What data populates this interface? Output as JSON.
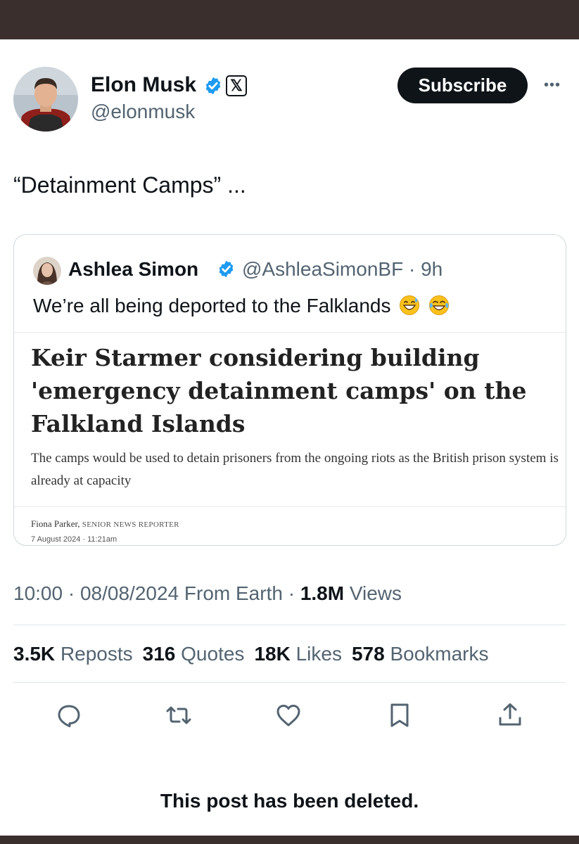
{
  "post": {
    "author_name": "Elon Musk",
    "author_handle": "@elonmusk",
    "badges": [
      "verified-badge-icon",
      "x-affiliate-badge-icon"
    ],
    "affiliate_badge_glyph": "𝕏",
    "subscribe_label": "Subscribe",
    "more_glyph": "•••",
    "text": "“Detainment Camps” ..."
  },
  "quote": {
    "author_name": "Ashlea Simon",
    "author_handle": "@AshleaSimonBF",
    "separator": "·",
    "time": "9h",
    "text": "We’re all being deported to the Falklands",
    "emojis": [
      "grinning-sweat-emoji",
      "tears-of-joy-emoji"
    ],
    "article": {
      "headline": "Keir Starmer considering building 'emergency detainment camps' on the Falkland Islands",
      "standfirst": "The camps would be used to detain prisoners from the ongoing riots as the British prison system is already at capacity",
      "author": "Fiona Parker,",
      "author_role": "SENIOR NEWS REPORTER",
      "date": "7 August 2024 · 11:21am"
    }
  },
  "meta": {
    "time": "10:00",
    "sep1": "·",
    "date": "08/08/2024",
    "source": "From Earth",
    "sep2": "·",
    "views_count": "1.8M",
    "views_label": "Views"
  },
  "stats": {
    "reposts_count": "3.5K",
    "reposts_label": "Reposts",
    "quotes_count": "316",
    "quotes_label": "Quotes",
    "likes_count": "18K",
    "likes_label": "Likes",
    "bookmarks_count": "578",
    "bookmarks_label": "Bookmarks"
  },
  "actions": [
    "reply-icon",
    "repost-icon",
    "like-icon",
    "bookmark-icon",
    "share-icon"
  ],
  "deleted_notice": "This post has been deleted.",
  "colors": {
    "text_primary": "#0f1419",
    "text_secondary": "#536471",
    "verified": "#1d9bf0",
    "frame": "#3b2f2e",
    "divider": "#e1e6ea"
  }
}
